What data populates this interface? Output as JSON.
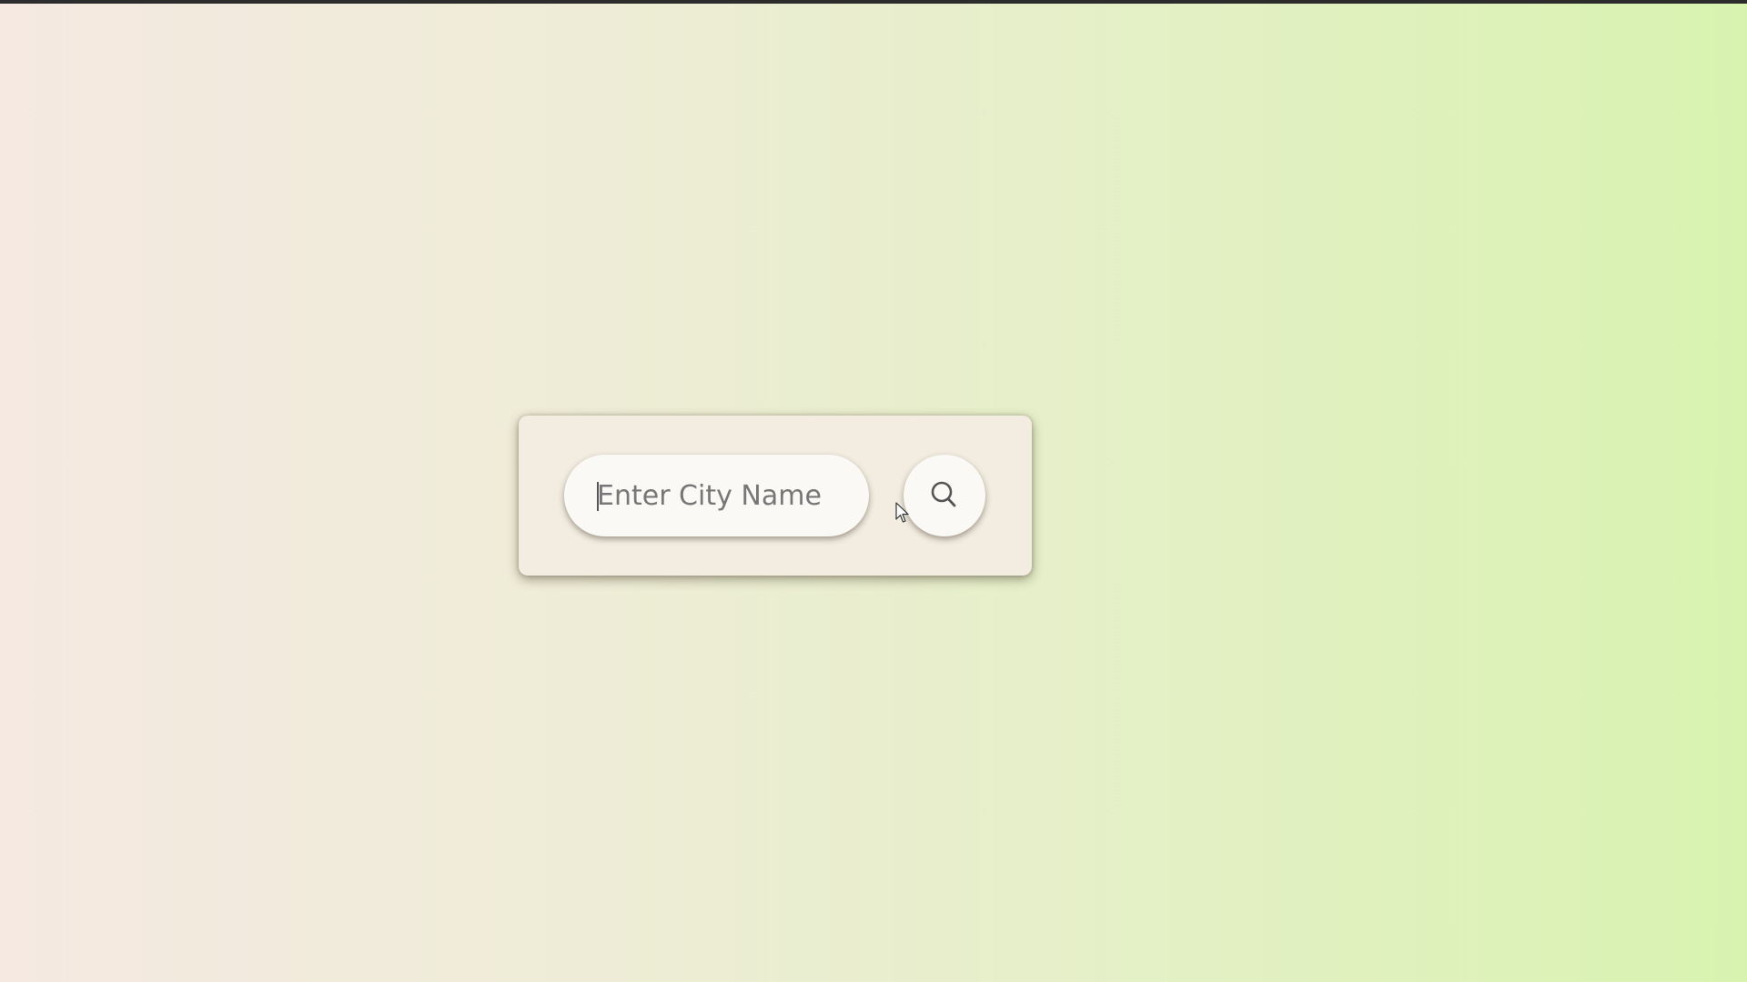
{
  "search": {
    "value": "",
    "placeholder": "Enter City Name"
  },
  "icons": {
    "search_button": "search-icon",
    "pointer": "mouse-cursor-icon"
  },
  "colors": {
    "background_left": "#f5e9e2",
    "background_right": "#d8f3b0",
    "card": "#f3ece1",
    "field": "#fbf9f5"
  }
}
